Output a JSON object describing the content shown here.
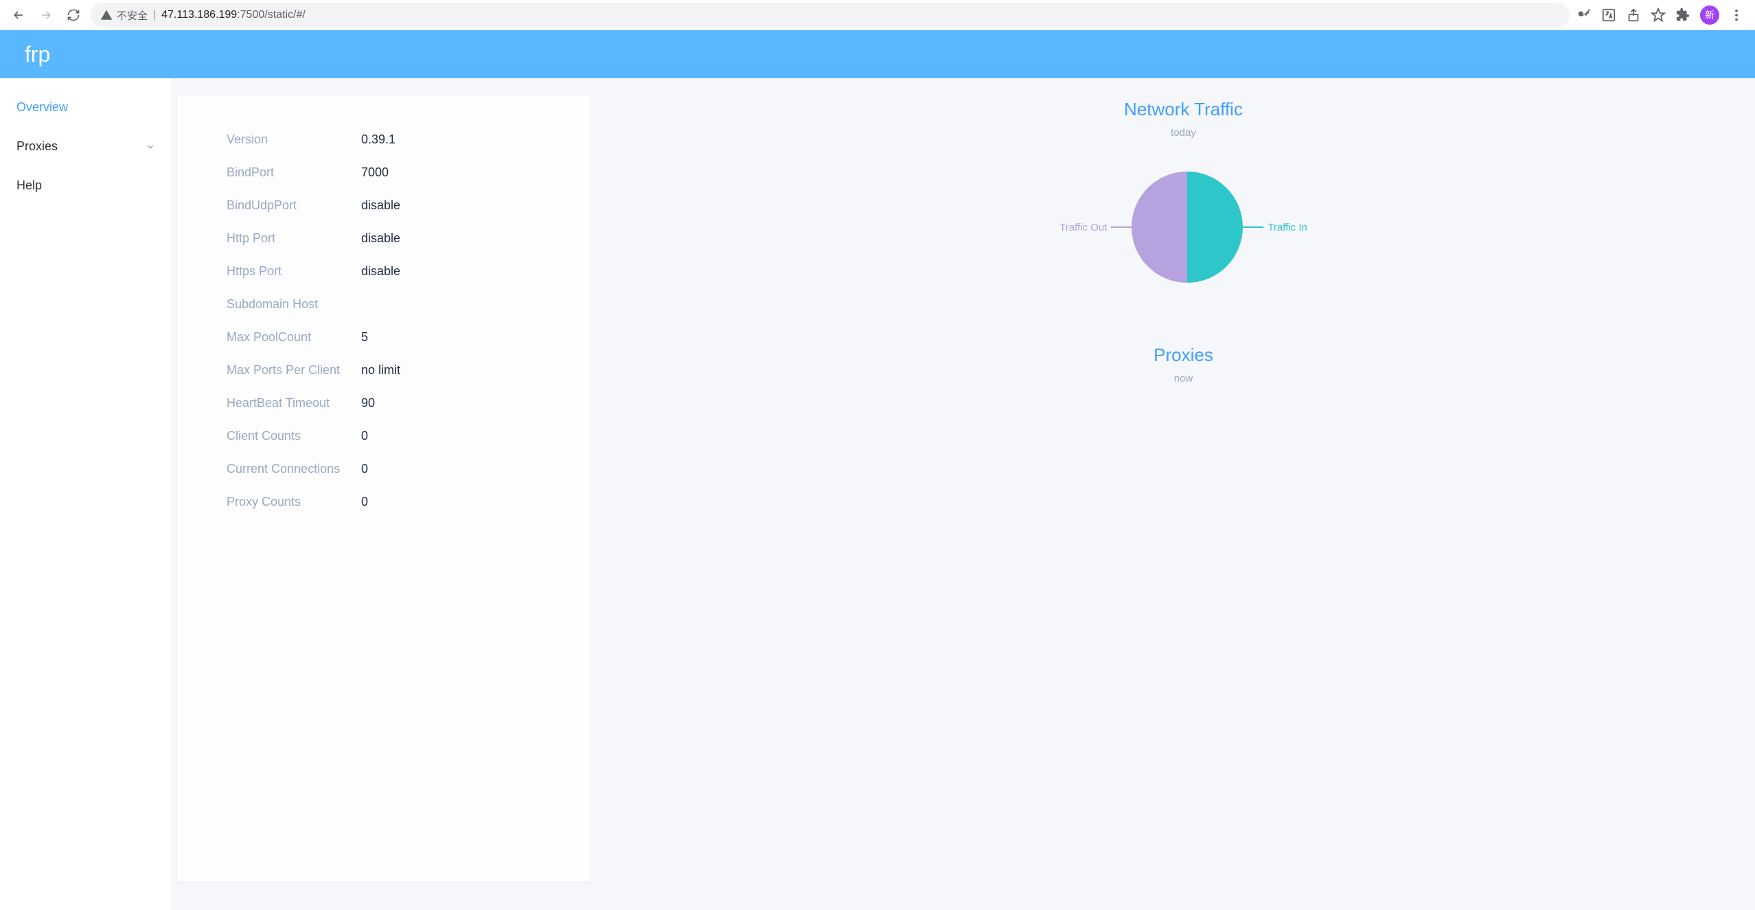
{
  "browser": {
    "security_text": "不安全",
    "url_host": "47.113.186.199",
    "url_port": ":7500",
    "url_path": "/static/#/",
    "avatar_char": "新"
  },
  "header": {
    "title": "frp"
  },
  "sidebar": {
    "overview": "Overview",
    "proxies": "Proxies",
    "help": "Help"
  },
  "info": {
    "rows": [
      {
        "label": "Version",
        "value": "0.39.1"
      },
      {
        "label": "BindPort",
        "value": "7000"
      },
      {
        "label": "BindUdpPort",
        "value": "disable"
      },
      {
        "label": "Http Port",
        "value": "disable"
      },
      {
        "label": "Https Port",
        "value": "disable"
      },
      {
        "label": "Subdomain Host",
        "value": ""
      },
      {
        "label": "Max PoolCount",
        "value": "5"
      },
      {
        "label": "Max Ports Per Client",
        "value": "no limit"
      },
      {
        "label": "HeartBeat Timeout",
        "value": "90"
      },
      {
        "label": "Client Counts",
        "value": "0"
      },
      {
        "label": "Current Connections",
        "value": "0"
      },
      {
        "label": "Proxy Counts",
        "value": "0"
      }
    ]
  },
  "traffic": {
    "title": "Network Traffic",
    "subtitle": "today",
    "legend_out": "Traffic Out",
    "legend_in": "Traffic In"
  },
  "proxies_section": {
    "title": "Proxies",
    "subtitle": "now"
  },
  "chart_data": {
    "type": "pie",
    "title": "Network Traffic",
    "series": [
      {
        "name": "Traffic Out",
        "value": 50,
        "color": "#b6a2de"
      },
      {
        "name": "Traffic In",
        "value": 50,
        "color": "#2ec7c9"
      }
    ]
  }
}
